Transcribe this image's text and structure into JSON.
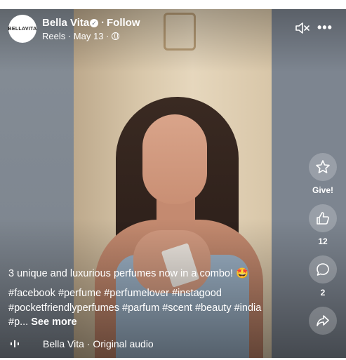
{
  "header": {
    "avatar_text": "BELLAVITA",
    "page_name": "Bella Vita",
    "separator": "·",
    "follow_label": "Follow",
    "source": "Reels · May 13 ·"
  },
  "actions": {
    "give_label": "Give!",
    "like_count": "12",
    "comment_count": "2"
  },
  "post": {
    "caption": "3 unique and luxurious perfumes now in a combo! 🤩",
    "hashtags_line1": "#facebook #perfume #perfumelover #instagood",
    "hashtags_line2": "#pocketfriendlyperfumes #parfum #scent #beauty #india",
    "hashtags_line3_prefix": "#p... ",
    "see_more_label": "See more"
  },
  "audio": {
    "label": "Bella Vita · Original audio"
  },
  "icons": {
    "verified": "verified-badge-icon",
    "globe": "globe-icon",
    "mute": "speaker-muted-icon",
    "more": "more-dots-icon",
    "give": "star-gift-icon",
    "like": "thumbs-up-icon",
    "comment": "comment-bubble-icon",
    "share": "share-arrow-icon",
    "audio": "audio-wave-icon"
  }
}
